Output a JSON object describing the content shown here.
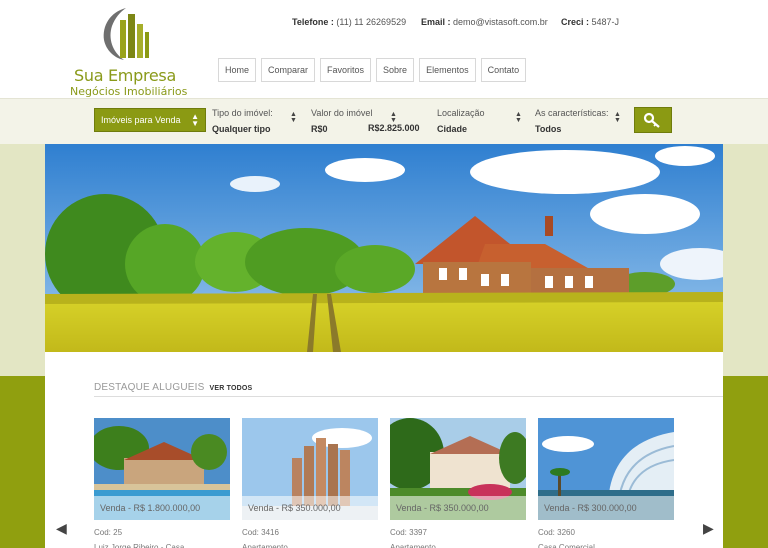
{
  "brand": {
    "name": "Sua Empresa",
    "tagline": "Negócios Imobiliários"
  },
  "contact": {
    "phone_label": "Telefone :",
    "phone": "(11) 11 26269529",
    "email_label": "Email :",
    "email": "demo@vistasoft.com.br",
    "creci_label": "Creci :",
    "creci": "5487-J"
  },
  "nav": [
    "Home",
    "Comparar",
    "Favoritos",
    "Sobre",
    "Elementos",
    "Contato"
  ],
  "search": {
    "type": "Imóveis para Venda",
    "tipo_label": "Tipo do imóvel:",
    "tipo_value": "Qualquer tipo",
    "valor_label": "Valor do imóvel",
    "valor_min": "R$0",
    "valor_max": "R$2.825.000",
    "local_label": "Localização",
    "local_value": "Cidade",
    "carac_label": "As características:",
    "carac_value": "Todos",
    "button_icon": "key-icon"
  },
  "section": {
    "title": "DESTAQUE ALUGUEIS",
    "link": "VER TODOS"
  },
  "cards": [
    {
      "price": "Venda - R$ 1.800.000,00",
      "code": "Cod: 25",
      "type": "Luiz Jorge Ribeiro - Casa"
    },
    {
      "price": "Venda - R$ 350.000,00",
      "code": "Cod: 3416",
      "type": "Apartamento"
    },
    {
      "price": "Venda - R$ 350.000,00",
      "code": "Cod: 3397",
      "type": "Apartamento"
    },
    {
      "price": "Venda - R$ 300.000,00",
      "code": "Cod: 3260",
      "type": "Casa Comercial"
    }
  ],
  "colors": {
    "accent": "#8b9a13",
    "band_light": "#e3e6c4",
    "band_dark": "#909f0f"
  },
  "icons": {
    "prev": "chevron-left-icon",
    "next": "chevron-right-icon"
  }
}
